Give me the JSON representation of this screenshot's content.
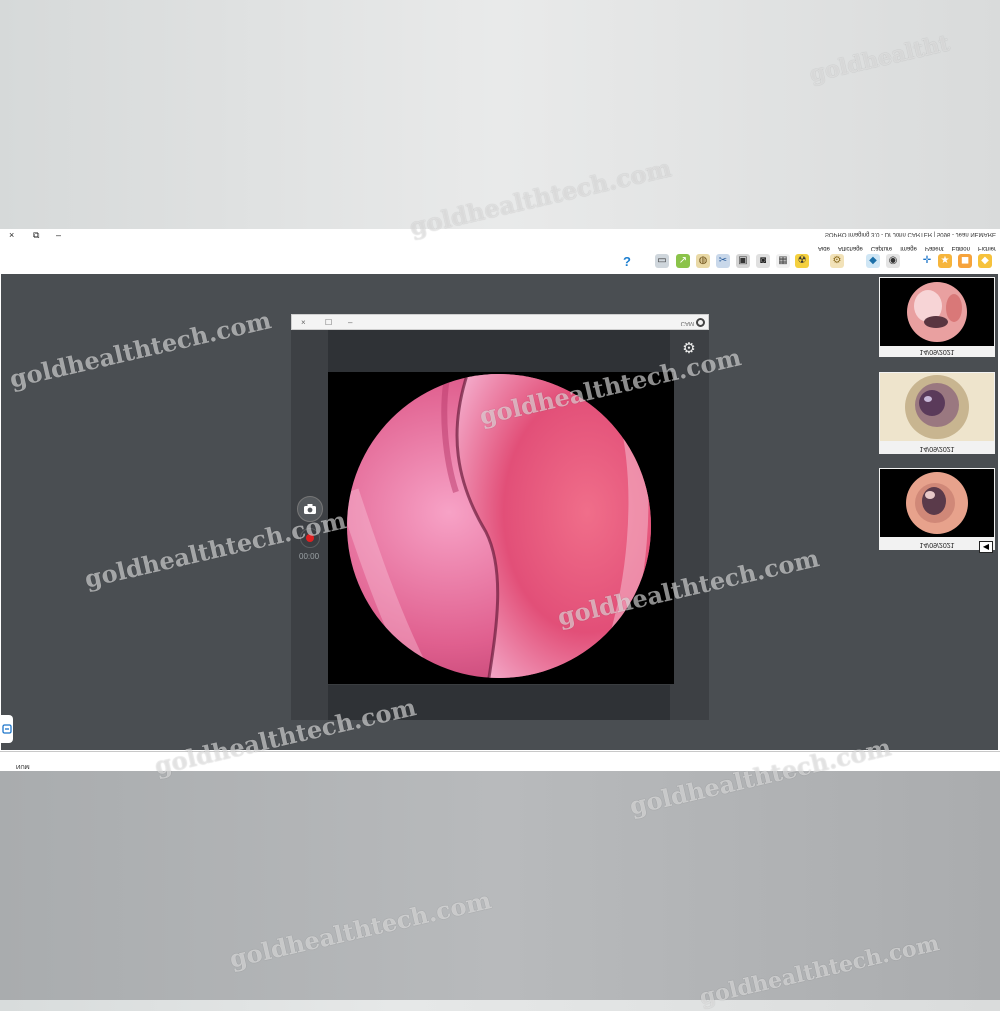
{
  "window": {
    "title": "SOPRO Imaging 3.0 - Dr John CARTER | 5096 - Jean NEMARE",
    "controls": [
      "×",
      "⧉",
      "–"
    ]
  },
  "menubar": [
    "Fichier",
    "Edition",
    "Patient",
    "Image",
    "Capture",
    "Affichage",
    "Aide"
  ],
  "toolbar": {
    "icons": [
      "help-icon",
      "scanner-icon",
      "export-icon",
      "compare-icon",
      "settings-icon",
      "tools-icon",
      "crop-icon",
      "camera-icon",
      "xray-icon",
      "calibration-icon",
      "monitor-icon",
      "eye-icon",
      "star-icon",
      "nav-icon"
    ],
    "help_label": "?"
  },
  "camera_window": {
    "controls": [
      "×",
      "☐",
      "–"
    ],
    "name": "CAM",
    "timer": "00:00"
  },
  "thumbnails": [
    {
      "date": "14/09/2021"
    },
    {
      "date": "14/09/2021"
    },
    {
      "date": "14/09/2021"
    }
  ],
  "statusbar": {
    "num": "NUM"
  },
  "watermark": "goldhealthtech.com",
  "watermark_partial": "goldhealtht",
  "colors": {
    "workspace": "#4a4e52",
    "record": "#e02020",
    "tissue": "#e05a8a"
  }
}
